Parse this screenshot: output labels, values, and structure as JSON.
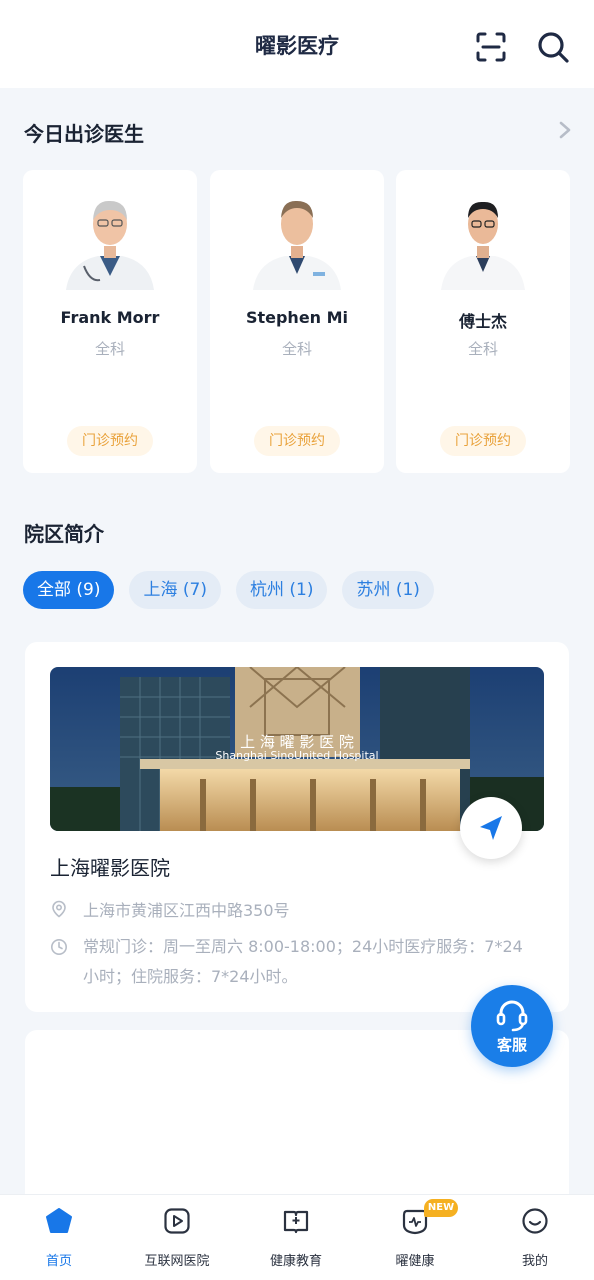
{
  "header": {
    "title": "曜影医疗"
  },
  "doctors_section": {
    "title": "今日出诊医生"
  },
  "doctors": [
    {
      "name": "Frank Morr",
      "dept": "全科",
      "book_label": "门诊预约"
    },
    {
      "name": "Stephen Mi",
      "dept": "全科",
      "book_label": "门诊预约"
    },
    {
      "name": "傅士杰",
      "dept": "全科",
      "book_label": "门诊预约"
    }
  ],
  "campus_section": {
    "title": "院区简介"
  },
  "filters": [
    {
      "label": "全部 (9)",
      "active": true
    },
    {
      "label": "上海 (7)",
      "active": false
    },
    {
      "label": "杭州 (1)",
      "active": false
    },
    {
      "label": "苏州 (1)",
      "active": false
    }
  ],
  "hospital": {
    "photo_sign_cn": "上 海 曜 影 医 院",
    "photo_sign_en": "Shanghai SinoUnited Hospital",
    "name": "上海曜影医院",
    "address": "上海市黄浦区江西中路350号",
    "hours": "常规门诊：周一至周六 8:00-18:00；24小时医疗服务：7*24小时；住院服务：7*24小时。"
  },
  "service_button": {
    "label": "客服"
  },
  "tabbar": {
    "items": [
      {
        "label": "首页",
        "icon": "home-icon",
        "active": true
      },
      {
        "label": "互联网医院",
        "icon": "play-icon",
        "active": false
      },
      {
        "label": "健康教育",
        "icon": "book-icon",
        "active": false
      },
      {
        "label": "曜健康",
        "icon": "health-icon",
        "active": false
      },
      {
        "label": "我的",
        "icon": "smile-icon",
        "active": false
      }
    ],
    "new_badge": "NEW"
  },
  "colors": {
    "accent": "#1877e8",
    "booking": "#e9a23b",
    "badge": "#f5b021"
  }
}
